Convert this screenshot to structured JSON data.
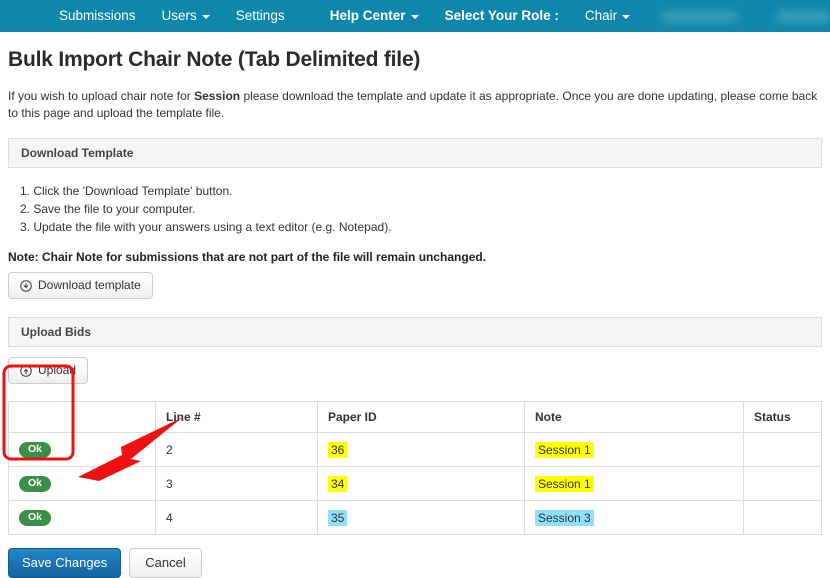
{
  "navbar": {
    "background_color": "#0e87ab",
    "items": [
      {
        "label": "Submissions",
        "has_caret": false,
        "bold": false
      },
      {
        "label": "Users",
        "has_caret": true,
        "bold": false
      },
      {
        "label": "Settings",
        "has_caret": false,
        "bold": false
      }
    ],
    "right_items": [
      {
        "label": "Help Center",
        "has_caret": true,
        "bold": true
      },
      {
        "label": "Select Your Role :",
        "has_caret": false,
        "bold": true
      },
      {
        "label": "Chair",
        "has_caret": true,
        "bold": false
      }
    ],
    "redacted_items": [
      "",
      ""
    ]
  },
  "page": {
    "title": "Bulk Import Chair Note (Tab Delimited file)",
    "intro_before": "If you wish to upload chair note for ",
    "intro_bold": "Session",
    "intro_after": " please download the template and update it as appropriate. Once you are done updating, please come back to this page and upload the template file."
  },
  "download_panel": {
    "heading": "Download Template",
    "steps": [
      "1. Click the 'Download Template' button.",
      "2. Save the file to your computer.",
      "3. Update the file with your answers using a text editor (e.g. Notepad)."
    ],
    "note": "Note: Chair Note for submissions that are not part of the file will remain unchanged.",
    "download_button_label": "Download template",
    "download_button_icon": "download-circle-icon"
  },
  "upload_panel": {
    "heading": "Upload Bids",
    "upload_button_label": "Upload",
    "upload_button_icon": "upload-circle-icon"
  },
  "table": {
    "columns": [
      "",
      "Line #",
      "Paper ID",
      "Note",
      "Status"
    ],
    "rows": [
      {
        "badge": "Ok",
        "line": "2",
        "paper_id": "36",
        "paper_id_highlight": "yellow",
        "note": "Session 1",
        "note_highlight": "yellow",
        "status": ""
      },
      {
        "badge": "Ok",
        "line": "3",
        "paper_id": "34",
        "paper_id_highlight": "yellow",
        "note": "Session 1",
        "note_highlight": "yellow",
        "status": ""
      },
      {
        "badge": "Ok",
        "line": "4",
        "paper_id": "35",
        "paper_id_highlight": "blue",
        "note": "Session 3",
        "note_highlight": "blue",
        "status": ""
      }
    ]
  },
  "footer": {
    "save_label": "Save Changes",
    "cancel_label": "Cancel"
  },
  "annotations": {
    "highlight_box_color": "#ee1111",
    "arrow_color": "#ee1111"
  },
  "colors": {
    "navbar": "#0e87ab",
    "badge_ok": "#3c8f47",
    "primary_button": "#1a7fc1",
    "highlight_yellow": "#ffff00",
    "highlight_blue": "#8fe0fb",
    "annotation_red": "#ee1111"
  }
}
